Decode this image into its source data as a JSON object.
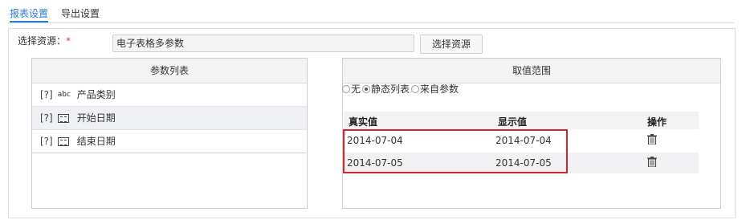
{
  "tabs": [
    {
      "label": "报表设置",
      "active": true
    },
    {
      "label": "导出设置",
      "active": false
    }
  ],
  "resource": {
    "label": "选择资源：",
    "required_mark": "*",
    "value": "电子表格多参数",
    "button_label": "选择资源"
  },
  "params_panel": {
    "title": "参数列表",
    "items": [
      {
        "mark": "[?]",
        "type": "abc",
        "label": "产品类别",
        "selected": false
      },
      {
        "mark": "[?]",
        "type": "date",
        "label": "开始日期",
        "selected": true
      },
      {
        "mark": "[?]",
        "type": "date",
        "label": "结束日期",
        "selected": false
      }
    ]
  },
  "range_panel": {
    "title": "取值范围",
    "options": [
      {
        "label": "无",
        "checked": false
      },
      {
        "label": "静态列表",
        "checked": true
      },
      {
        "label": "来自参数",
        "checked": false
      }
    ],
    "table": {
      "headers": {
        "real": "真实值",
        "display": "显示值",
        "action": "操作"
      },
      "rows": [
        {
          "real": "2014-07-04",
          "display": "2014-07-04"
        },
        {
          "real": "2014-07-05",
          "display": "2014-07-05"
        }
      ]
    }
  },
  "colors": {
    "accent": "#2a7ad4",
    "highlight": "#d9232a",
    "required": "#e23a3a"
  }
}
